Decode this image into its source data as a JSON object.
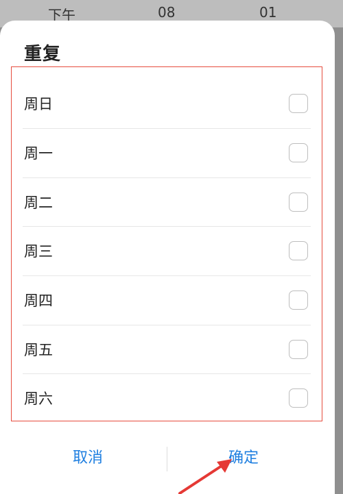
{
  "background_picker": {
    "period": "下午",
    "hour": "08",
    "minute": "01"
  },
  "dialog": {
    "title": "重复",
    "items": [
      {
        "label": "周日",
        "checked": false
      },
      {
        "label": "周一",
        "checked": false
      },
      {
        "label": "周二",
        "checked": false
      },
      {
        "label": "周三",
        "checked": false
      },
      {
        "label": "周四",
        "checked": false
      },
      {
        "label": "周五",
        "checked": false
      },
      {
        "label": "周六",
        "checked": false
      }
    ],
    "cancel_label": "取消",
    "confirm_label": "确定"
  },
  "colors": {
    "accent": "#1f7fe0",
    "highlight_border": "#e64a3c",
    "annotation_arrow": "#e53935"
  },
  "icons": {
    "annotation": "arrow-icon",
    "watermark": "baidu-jingyan-logo-icon"
  }
}
